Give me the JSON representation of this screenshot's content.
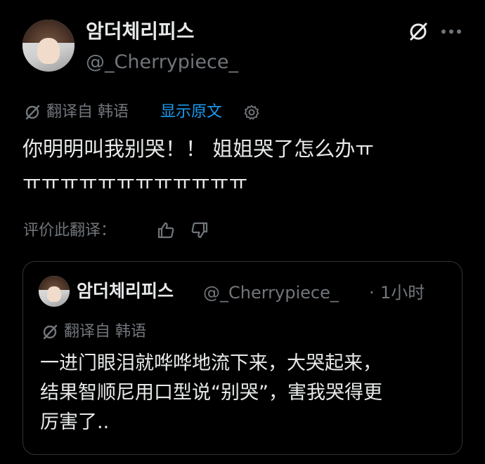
{
  "post": {
    "author_name": "암더체리피스",
    "author_handle": "@_Cherrypiece_",
    "translation_bar": {
      "label": "翻译自 韩语",
      "show_original": "显示原文"
    },
    "body_line1": "你明明叫我别哭！！ 姐姐哭了怎么办ㅠ",
    "body_line2": "ㅠㅠㅠㅠㅠㅠㅠㅠㅠㅠㅠㅠ",
    "rate_translation": "评价此翻译："
  },
  "quote": {
    "author_name": "암더체리피스",
    "author_handle": "@_Cherrypiece_",
    "separator": "·",
    "time": "1小时",
    "translation_label": "翻译自 韩语",
    "text_line1": "一进门眼泪就哗哗地流下来，大哭起来，",
    "text_line2": "结果智顺尼用口型说“别哭”，害我哭得更",
    "text_line3": "厉害了.."
  },
  "icons": {
    "translate": "translate-off-icon",
    "more": "more-icon",
    "settings": "gear-icon",
    "thumbs_up": "thumbs-up-icon",
    "thumbs_down": "thumbs-down-icon"
  },
  "colors": {
    "background": "#000000",
    "text": "#e7e9ea",
    "muted": "#71767b",
    "link": "#1d9bf0",
    "border": "#2f3336"
  }
}
